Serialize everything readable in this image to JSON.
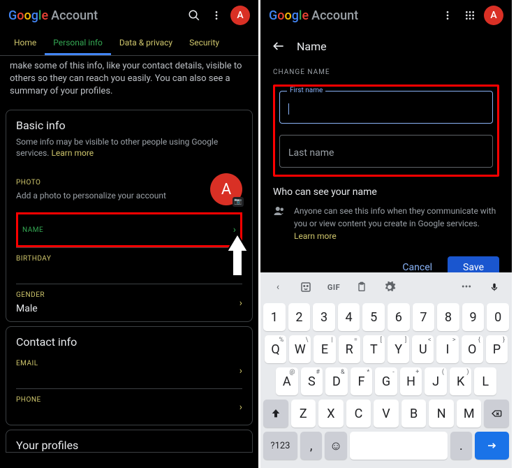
{
  "left": {
    "header": {
      "logo": "Google",
      "account": "Account",
      "avatar": "A"
    },
    "tabs": [
      "Home",
      "Personal info",
      "Data & privacy",
      "Security"
    ],
    "intro": "make some of this info, like your contact details, visible to others so they can reach you easily. You can also see a summary of your profiles.",
    "basic": {
      "title": "Basic info",
      "desc": "Some info may be visible to other people using Google services. ",
      "learn": "Learn more",
      "photo_label": "PHOTO",
      "photo_desc": "Add a photo to personalize your account",
      "photo_letter": "A",
      "name_label": "NAME",
      "birthday_label": "BIRTHDAY",
      "gender_label": "GENDER",
      "gender_value": "Male"
    },
    "contact": {
      "title": "Contact info",
      "email_label": "EMAIL",
      "phone_label": "PHONE"
    },
    "profiles": "Your profiles"
  },
  "right": {
    "header": {
      "logo": "Google",
      "account": "Account",
      "avatar": "A"
    },
    "page_title": "Name",
    "section_label": "CHANGE NAME",
    "first_label": "First name",
    "last_label": "Last name",
    "who_title": "Who can see your name",
    "who_desc": "Anyone can see this info when they communicate with you or view content you create in Google services. ",
    "learn": "Learn more",
    "cancel": "Cancel",
    "save": "Save",
    "kbd": {
      "gif": "GIF",
      "r1": [
        "1",
        "2",
        "3",
        "4",
        "5",
        "6",
        "7",
        "8",
        "9",
        "0"
      ],
      "r2": [
        "Q",
        "W",
        "E",
        "R",
        "T",
        "Y",
        "U",
        "I",
        "O",
        "P"
      ],
      "r2s": [
        "%",
        "\\",
        "|",
        "=",
        "[",
        "]",
        "<",
        ">",
        "{",
        "}"
      ],
      "r3": [
        "A",
        "S",
        "D",
        "F",
        "G",
        "H",
        "J",
        "K",
        "L"
      ],
      "r3s": [
        "@",
        "#",
        "&",
        "*",
        "-",
        "+",
        "(",
        ")",
        ""
      ],
      "r4": [
        "Z",
        "X",
        "C",
        "V",
        "B",
        "N",
        "M"
      ],
      "sym": "?123",
      "comma": ",",
      "period": "."
    }
  }
}
